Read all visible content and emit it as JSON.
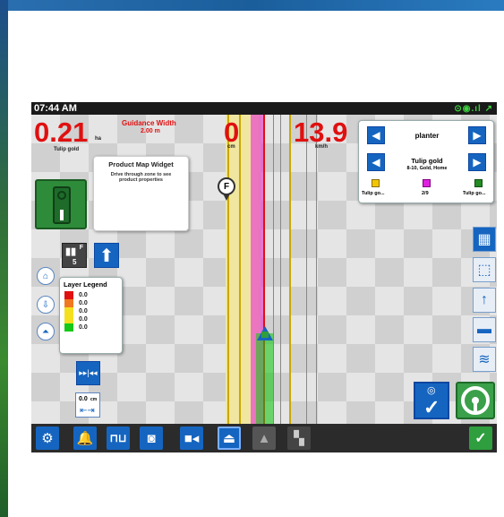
{
  "status": {
    "time": "07:44 AM"
  },
  "readouts": {
    "area_value": "0.21",
    "area_unit": "ha",
    "area_product": "Tulip gold",
    "guidance_title": "Guidance Width",
    "guidance_value": "2.00",
    "guidance_unit": "m",
    "offset_value": "0",
    "offset_unit": "cm",
    "speed_value": "13.9",
    "speed_unit": "km/h"
  },
  "product_widget": {
    "title": "Product Map Widget",
    "hint": "Drive through zone to see product properties"
  },
  "implement": {
    "name": "planter",
    "product_name": "Tulip gold",
    "product_detail": "8-10, Gold, Home",
    "left_label": "Tulip go...",
    "center_label": "2/9",
    "right_label": "Tulip go..."
  },
  "marker": {
    "label": "F"
  },
  "section": {
    "letter": "F",
    "number": "5"
  },
  "layer_legend": {
    "title": "Layer Legend",
    "rows": [
      {
        "value": "0.0",
        "color": "#e01010"
      },
      {
        "value": "0.0",
        "color": "#f07820"
      },
      {
        "value": "0.0",
        "color": "#f5e020"
      },
      {
        "value": "0.0",
        "color": "#f5e020"
      },
      {
        "value": "0.0",
        "color": "#18c818"
      }
    ]
  },
  "nudge": {
    "value": "0.0",
    "unit": "cm"
  },
  "colors": {
    "accent": "#1565c0",
    "alert": "#e01010",
    "ok": "#2e9e3e",
    "toolbar": "#2b2b2b"
  },
  "toolbar_icons": [
    "gear-icon",
    "bell-icon",
    "implement-icon",
    "camera-icon",
    "video-icon",
    "guidance-icon",
    "boundary-icon",
    "split-view-icon",
    "check-icon"
  ]
}
